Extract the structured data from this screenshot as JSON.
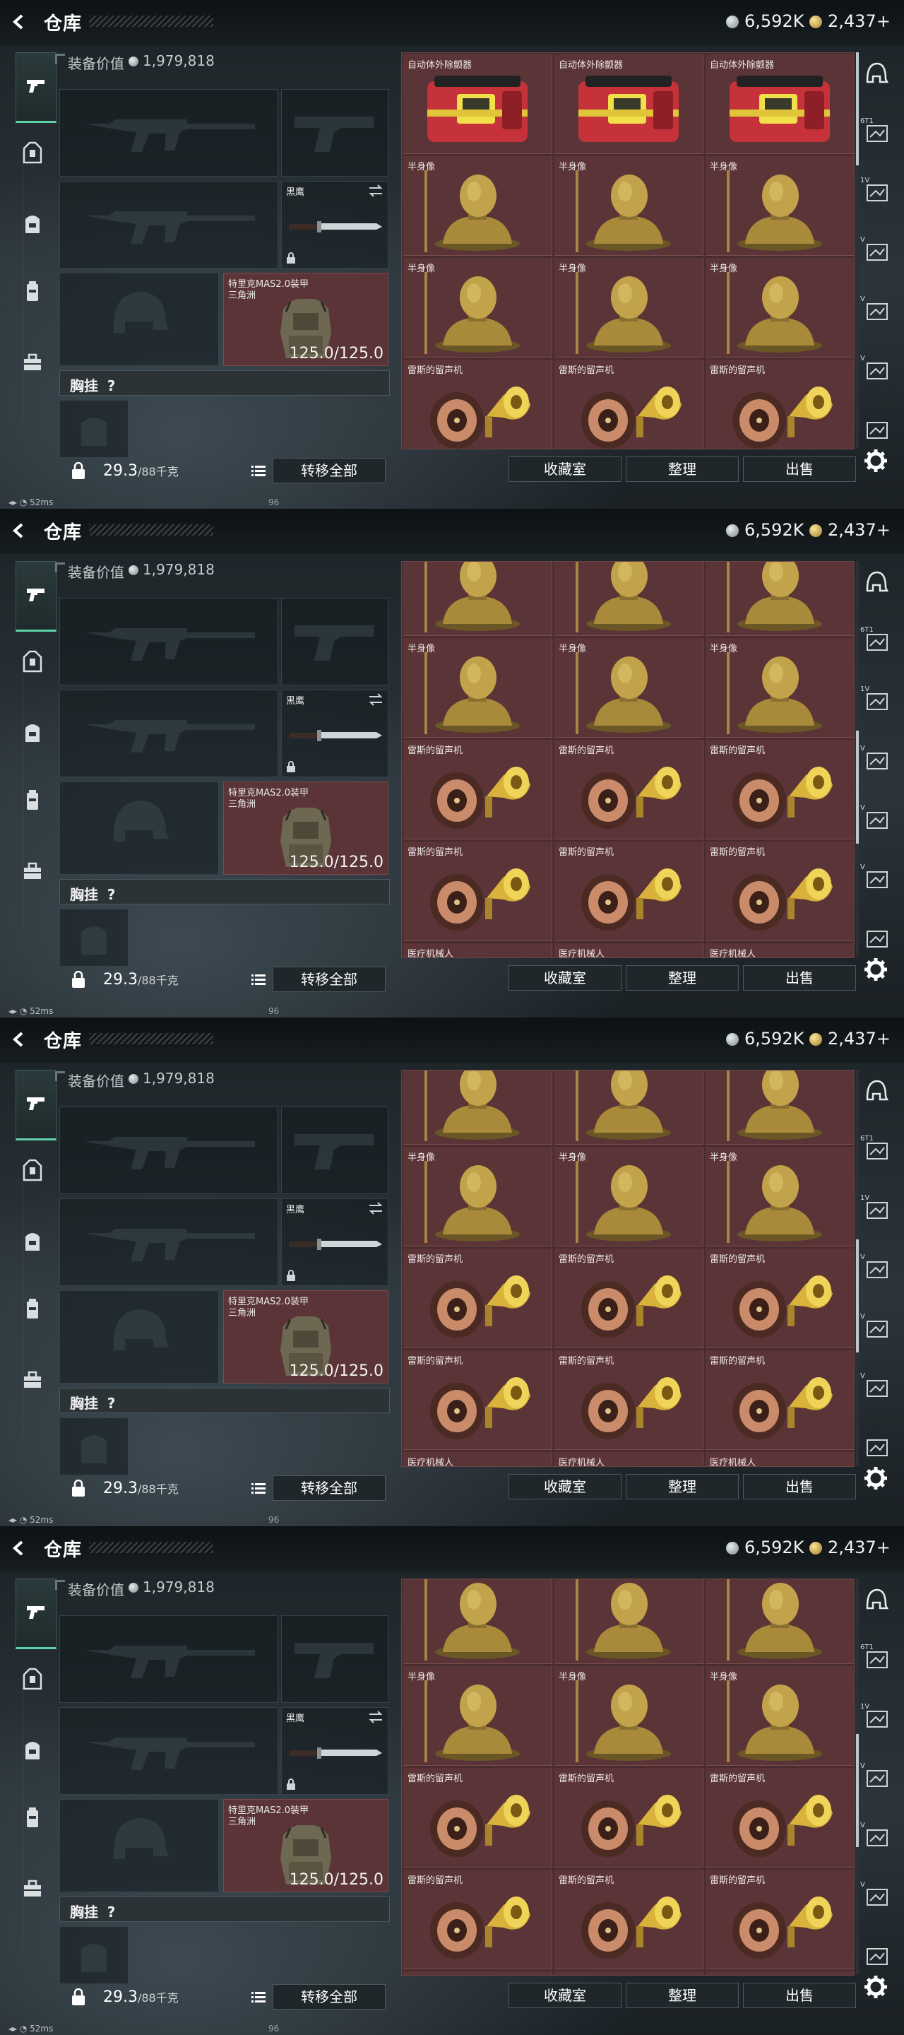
{
  "screen": {
    "title": "仓库",
    "currency": [
      {
        "icon": "silver-coin-icon",
        "value": "6,592K",
        "color": "#a9b0b4"
      },
      {
        "icon": "gold-coin-icon",
        "value": "2,437+",
        "color": "#c9a64a"
      }
    ],
    "equip_value_label": "装备价值",
    "equip_value": "1,979,818",
    "slots": {
      "knife_label": "黑鹰",
      "armor_title": "特里克MAS2.0装甲",
      "armor_sub": "三角洲",
      "armor_durability": "125.0/125.0",
      "chest_label": "胸挂",
      "chest_value": "?"
    },
    "weight_value": "29.3",
    "weight_unit": "/88千克",
    "buttons": {
      "transfer_all": "转移全部",
      "collection": "收藏室",
      "organize": "整理",
      "sell": "出售"
    },
    "status_ping": "52ms",
    "status_extra": "96"
  },
  "grid_rows": [
    {
      "label": "自动体外除颤器",
      "icon": "defibrillator-icon"
    },
    {
      "label": "半身像",
      "icon": "bust-statue-icon"
    },
    {
      "label": "半身像",
      "icon": "bust-statue-icon"
    },
    {
      "label": "雷斯的留声机",
      "icon": "gramophone-icon"
    },
    {
      "label": "雷斯的留声机",
      "icon": "gramophone-icon"
    },
    {
      "label": "医疗机械人",
      "icon": "medical-robot-icon"
    }
  ],
  "frames": [
    {
      "scroll_position_percent": 0
    },
    {
      "scroll_position_percent": 60
    },
    {
      "scroll_position_percent": 60
    },
    {
      "scroll_position_percent": 55
    }
  ],
  "rail": [
    {
      "icon": "helmet-rail-icon",
      "label": ""
    },
    {
      "icon": "rail-item-icon",
      "label": "6T1"
    },
    {
      "icon": "rail-item-icon",
      "label": "1V"
    },
    {
      "icon": "rail-item-icon",
      "label": "V"
    },
    {
      "icon": "rail-item-icon",
      "label": "V"
    },
    {
      "icon": "rail-item-icon",
      "label": "V"
    },
    {
      "icon": "rail-item-icon",
      "label": ""
    }
  ]
}
